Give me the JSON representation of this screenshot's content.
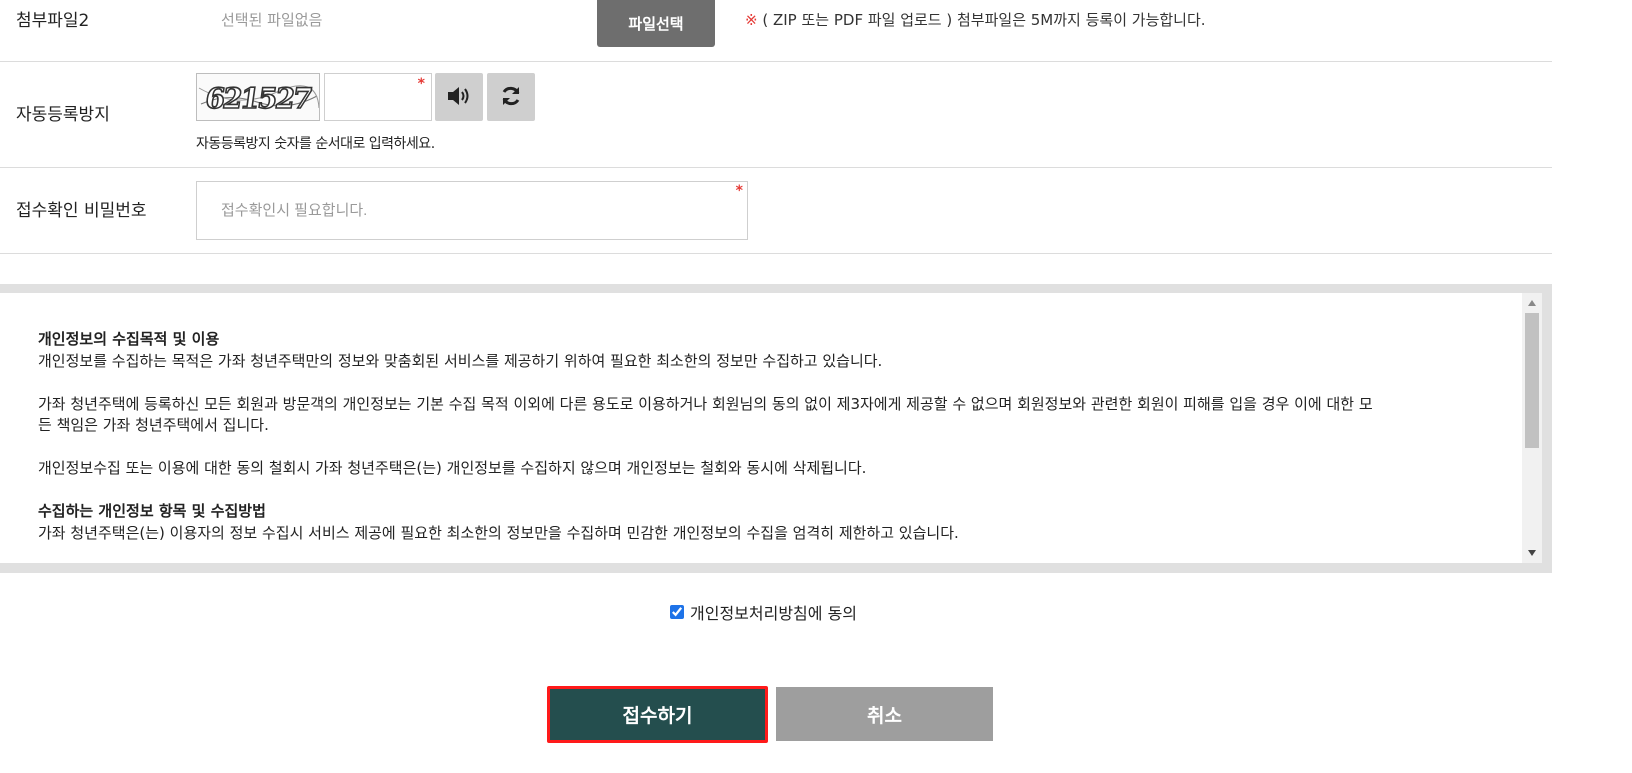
{
  "attachment": {
    "label": "첨부파일2",
    "status": "선택된 파일없음",
    "button_label": "파일선택",
    "note_mark": "※",
    "note_text": " ( ZIP 또는 PDF 파일 업로드 ) 첨부파일은 5M까지 등록이 가능합니다."
  },
  "captcha": {
    "label": "자동등록방지",
    "image_text": "621527",
    "input_value": "",
    "required_mark": "*",
    "help": "자동등록방지 숫자를 순서대로 입력하세요.",
    "audio_icon": "speaker-icon",
    "refresh_icon": "refresh-icon"
  },
  "password": {
    "label": "접수확인 비밀번호",
    "placeholder": "접수확인시 필요합니다.",
    "required_mark": "*"
  },
  "privacy": {
    "section1_title": "개인정보의 수집목적 및 이용",
    "section1_p1": "개인정보를 수집하는 목적은 가좌 청년주택만의 정보와 맞춤회된 서비스를 제공하기 위하여 필요한 최소한의 정보만 수집하고 있습니다.",
    "section1_p2a": "가좌 청년주택에 등록하신 모든 회원과 방문객의 개인정보는 기본 수집 목적 이외에 다른 용도로 이용하거나 회원님의 동의 없이 제3자에게 제공할 수 없으며 회원정보와 관련한 회원이 피해를 입을 경우 이에 대한 모",
    "section1_p2b": "든 책임은 가좌 청년주택에서 집니다.",
    "section1_p3": "개인정보수집 또는 이용에 대한 동의 철회시 가좌 청년주택은(는) 개인정보를 수집하지 않으며 개인정보는 철회와 동시에 삭제됩니다.",
    "section2_title": "수집하는 개인정보 항목 및 수집방법",
    "section2_p1": "가좌 청년주택은(는) 이용자의 정보 수집시 서비스 제공에 필요한 최소한의 정보만을 수집하며 민감한 개인정보의 수집을 엄격히 제한하고 있습니다."
  },
  "agree": {
    "label": "개인정보처리방침에 동의",
    "checked": true
  },
  "actions": {
    "submit_label": "접수하기",
    "cancel_label": "취소"
  },
  "colors": {
    "submit_bg": "#244e4e",
    "submit_highlight": "#ff1a1a",
    "cancel_bg": "#9e9e9e",
    "file_button_bg": "#6e6e6e",
    "required": "#e53935"
  }
}
